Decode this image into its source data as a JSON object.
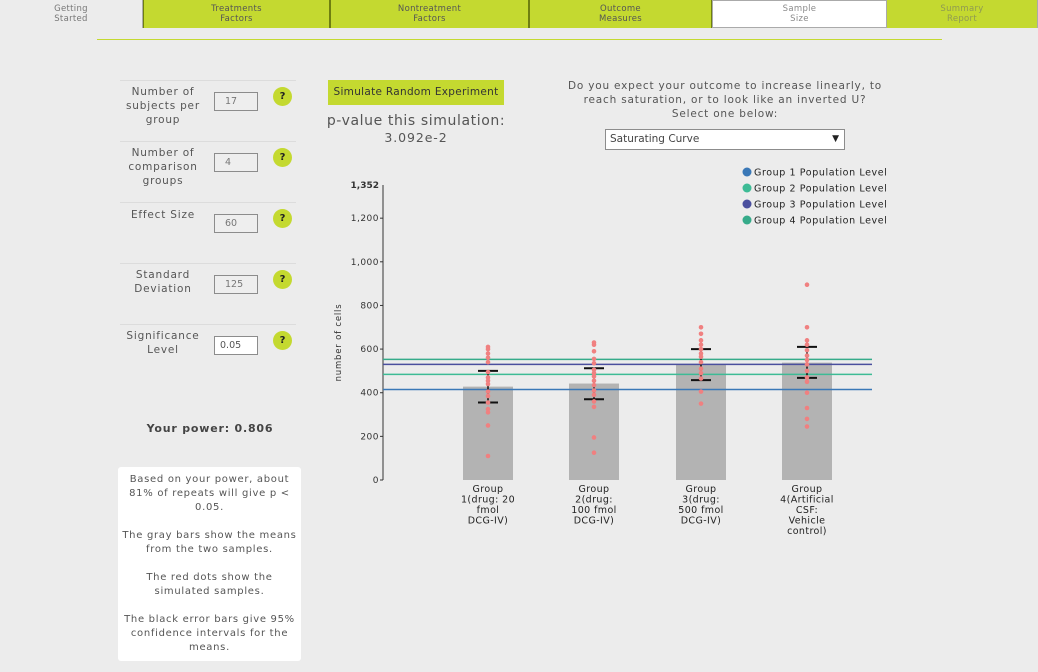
{
  "tabs": [
    {
      "line1": "Getting",
      "line2": "Started"
    },
    {
      "line1": "Treatments",
      "line2": "Factors"
    },
    {
      "line1": "Nontreatment",
      "line2": "Factors"
    },
    {
      "line1": "Outcome",
      "line2": "Measures"
    },
    {
      "line1": "Sample",
      "line2": "Size"
    },
    {
      "line1": "Summary",
      "line2": "Report"
    }
  ],
  "params": {
    "subjects": {
      "label": "Number of subjects per group",
      "value": "17"
    },
    "groups": {
      "label": "Number of comparison groups",
      "value": "4"
    },
    "effect": {
      "label": "Effect Size",
      "value": "60"
    },
    "sd": {
      "label": "Standard Deviation",
      "value": "125"
    },
    "significance": {
      "label": "Significance Level",
      "value": "0.05"
    },
    "help_label": "?"
  },
  "power_text": "Your power: 0.806",
  "info": {
    "p1": "Based on your power, about 81% of repeats will give p < 0.05.",
    "p2": "The gray bars show the means from the two samples.",
    "p3": "The red dots show the simulated samples.",
    "p4": "The black error bars give 95% confidence intervals for the means."
  },
  "simulate_button": "Simulate Random Experiment",
  "pvalue": {
    "label": "p-value this simulation:",
    "value": "3.092e-2"
  },
  "question": "Do you expect your outcome to increase linearly, to reach saturation, or to look like an inverted U? Select one below:",
  "curve_select": {
    "selected": "Saturating Curve",
    "arrow": "▼"
  },
  "chart_data": {
    "type": "bar",
    "ylabel": "number of cells",
    "yticks": [
      0,
      200,
      400,
      600,
      800,
      1000,
      1200
    ],
    "ymax_label": "1,352",
    "ylim": [
      0,
      1352
    ],
    "categories": [
      [
        "Group",
        "1(drug: 20",
        "fmol",
        "DCG-IV)"
      ],
      [
        "Group",
        "2(drug:",
        "100 fmol",
        "DCG-IV)"
      ],
      [
        "Group",
        "3(drug:",
        "500 fmol",
        "DCG-IV)"
      ],
      [
        "Group",
        "4(Artificial",
        "CSF:",
        "Vehicle",
        "control)"
      ]
    ],
    "means": [
      428,
      442,
      530,
      538
    ],
    "ci_low": [
      355,
      370,
      458,
      468
    ],
    "ci_high": [
      500,
      512,
      600,
      610
    ],
    "points": [
      [
        110,
        250,
        310,
        325,
        355,
        385,
        405,
        440,
        455,
        470,
        495,
        540,
        560,
        580,
        600,
        610
      ],
      [
        125,
        195,
        335,
        360,
        390,
        410,
        435,
        455,
        475,
        490,
        505,
        535,
        555,
        590,
        620,
        630
      ],
      [
        350,
        405,
        465,
        490,
        510,
        540,
        565,
        580,
        600,
        620,
        640,
        670,
        700
      ],
      [
        245,
        280,
        330,
        400,
        450,
        470,
        500,
        530,
        550,
        570,
        595,
        620,
        640,
        700,
        895
      ]
    ],
    "population_levels": [
      {
        "name": "Group 1 Population Level",
        "value": 415,
        "color": "#3a78b7"
      },
      {
        "name": "Group 2 Population Level",
        "value": 484,
        "color": "#3dbb95"
      },
      {
        "name": "Group 3 Population Level",
        "value": 530,
        "color": "#4a4f9e"
      },
      {
        "name": "Group 4 Population Level",
        "value": 553,
        "color": "#36ab8a"
      }
    ],
    "colors": {
      "bar": "#b3b3b3",
      "dot": "#f08080",
      "error": "#111111"
    },
    "legend_position": "top-right"
  }
}
